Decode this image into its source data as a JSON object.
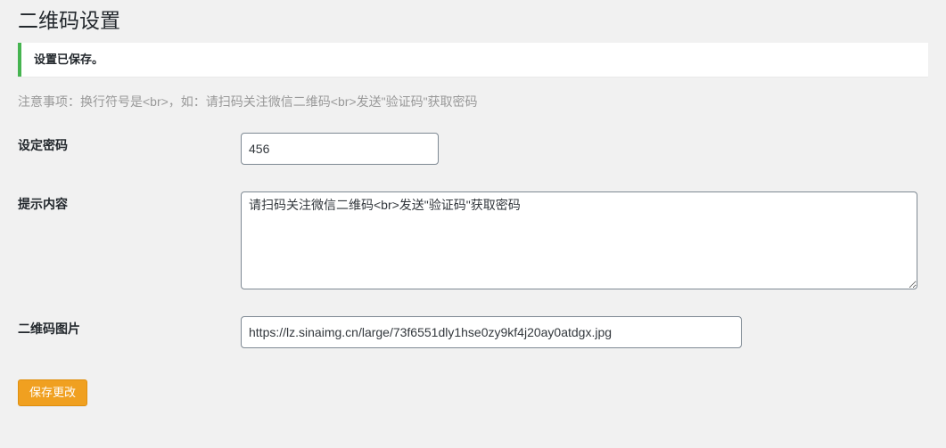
{
  "heading": "二维码设置",
  "notice_message": "设置已保存。",
  "hint_text": "注意事项：换行符号是<br>，如：请扫码关注微信二维码<br>发送\"验证码\"获取密码",
  "fields": {
    "password": {
      "label": "设定密码",
      "value": "456"
    },
    "hint_content": {
      "label": "提示内容",
      "value": "请扫码关注微信二维码<br>发送\"验证码\"获取密码"
    },
    "qrcode_image": {
      "label": "二维码图片",
      "value": "https://lz.sinaimg.cn/large/73f6551dly1hse0zy9kf4j20ay0atdgx.jpg"
    }
  },
  "submit_label": "保存更改"
}
